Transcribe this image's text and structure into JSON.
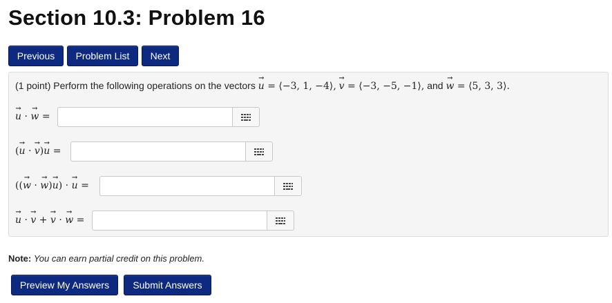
{
  "page": {
    "title": "Section 10.3: Problem 16"
  },
  "nav": {
    "previous": "Previous",
    "problem_list": "Problem List",
    "next": "Next"
  },
  "problem": {
    "points": "(1 point)",
    "text_before": "Perform the following operations on the vectors",
    "u_value": "= ⟨−3, 1, −4⟩,",
    "v_value": "= ⟨−3, −5, −1⟩,",
    "and_text": "and",
    "w_value": "= ⟨5, 3, 3⟩."
  },
  "answers": [
    {
      "label_tail": "=",
      "value": ""
    },
    {
      "label_tail": "=",
      "value": ""
    },
    {
      "label_tail": "=",
      "value": ""
    },
    {
      "label_tail": "=",
      "value": ""
    }
  ],
  "note": {
    "label": "Note:",
    "text": "You can earn partial credit on this problem."
  },
  "submit": {
    "preview": "Preview My Answers",
    "submit": "Submit Answers"
  },
  "icons": {
    "keyboard": "keyboard-grid-icon"
  },
  "colors": {
    "button_bg": "#0d2a80",
    "panel_bg": "#f5f5f5"
  }
}
